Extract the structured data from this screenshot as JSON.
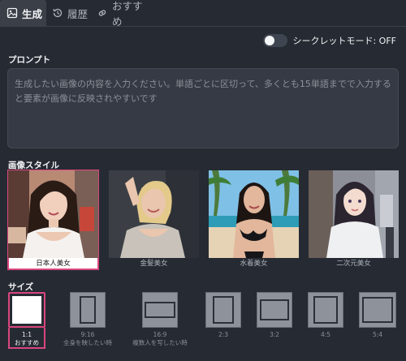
{
  "tabs": [
    {
      "label": "生成",
      "icon": "image-icon",
      "active": true
    },
    {
      "label": "履歴",
      "icon": "history-icon",
      "active": false
    },
    {
      "label": "おすすめ",
      "icon": "link-icon",
      "active": false
    }
  ],
  "secret_mode": {
    "label": "シークレットモード: OFF",
    "on": false
  },
  "prompt": {
    "label": "プロンプト",
    "placeholder": "生成したい画像の内容を入力ください。単語ごとに区切って、多くとも15単語までで入力すると要素が画像に反映されやすいです"
  },
  "style": {
    "label": "画像スタイル",
    "items": [
      {
        "caption": "日本人美女",
        "selected": true
      },
      {
        "caption": "金髪美女",
        "selected": false
      },
      {
        "caption": "水着美女",
        "selected": false
      },
      {
        "caption": "二次元美女",
        "selected": false
      }
    ]
  },
  "size": {
    "label": "サイズ",
    "items": [
      {
        "ratio": "1:1",
        "note": "おすすめ",
        "selected": true
      },
      {
        "ratio": "9:16",
        "note": "全身を映したい時",
        "selected": false
      },
      {
        "ratio": "16:9",
        "note": "複数人を写したい時",
        "selected": false
      },
      {
        "ratio": "2:3",
        "note": "",
        "selected": false
      },
      {
        "ratio": "3:2",
        "note": "",
        "selected": false
      },
      {
        "ratio": "4:5",
        "note": "",
        "selected": false
      },
      {
        "ratio": "5:4",
        "note": "",
        "selected": false
      }
    ]
  },
  "colors": {
    "accent": "#d9467e",
    "background": "#262b33",
    "panel": "#353a44"
  }
}
